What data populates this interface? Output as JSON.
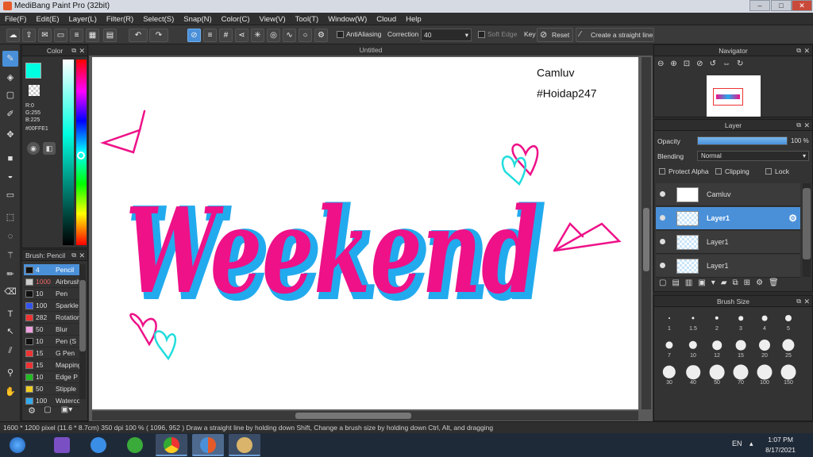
{
  "window": {
    "title": "MediBang Paint Pro (32bit)",
    "minimize": "–",
    "maximize": "□",
    "close": "✕"
  },
  "menu": [
    "File(F)",
    "Edit(E)",
    "Layer(L)",
    "Filter(R)",
    "Select(S)",
    "Snap(N)",
    "Color(C)",
    "View(V)",
    "Tool(T)",
    "Window(W)",
    "Cloud",
    "Help"
  ],
  "toolbar": {
    "antialiasing_label": "AntiAliasing",
    "correction_label": "Correction",
    "correction_value": "40",
    "soft_edge_label": "Soft Edge",
    "key_label": "Key",
    "reset_label": "Reset",
    "straight_line_label": "Create a straight line"
  },
  "color_panel": {
    "title": "Color",
    "r": "R:0",
    "g": "G:255",
    "b": "B:225",
    "hex": "#00FFE1",
    "foreground_color": "#00ffe1",
    "background_color": "#000000"
  },
  "brush_panel": {
    "title": "Brush: Pencil",
    "items": [
      {
        "size": "4",
        "name": "Pencil",
        "color": "#111111",
        "selected": true
      },
      {
        "size": "1000",
        "name": "Airbrush",
        "color": "#cccccc"
      },
      {
        "size": "10",
        "name": "Pen",
        "color": "#111111"
      },
      {
        "size": "100",
        "name": "Sparkle",
        "color": "#3355ee"
      },
      {
        "size": "282",
        "name": "Rotation",
        "color": "#ee3333"
      },
      {
        "size": "50",
        "name": "Blur",
        "color": "#f0a0e0"
      },
      {
        "size": "10",
        "name": "Pen (S",
        "color": "#111111"
      },
      {
        "size": "15",
        "name": "G Pen",
        "color": "#ee3333"
      },
      {
        "size": "15",
        "name": "Mapping",
        "color": "#ee3333"
      },
      {
        "size": "10",
        "name": "Edge P",
        "color": "#22bb22"
      },
      {
        "size": "50",
        "name": "Stipple",
        "color": "#eecc22"
      },
      {
        "size": "100",
        "name": "Watercolor",
        "color": "#33aaee"
      }
    ]
  },
  "canvas": {
    "doc_title": "Untitled",
    "artwork_text": "Weekend",
    "signature_line1": "Camluv",
    "signature_line2": "#Hoidap247",
    "colors": {
      "pink": "#ee1188",
      "cyan": "#22aaee",
      "teal": "#22dddd"
    }
  },
  "navigator": {
    "title": "Navigator"
  },
  "layer_panel": {
    "title": "Layer",
    "opacity_label": "Opacity",
    "opacity_value": "100 %",
    "opacity_fraction": 1.0,
    "blending_label": "Blending",
    "blending_value": "Normal",
    "protect_alpha_label": "Protect Alpha",
    "clipping_label": "Clipping",
    "lock_label": "Lock",
    "layers": [
      {
        "name": "Camluv",
        "selected": false
      },
      {
        "name": "Layer1",
        "selected": true
      },
      {
        "name": "Layer1",
        "selected": false
      },
      {
        "name": "Layer1",
        "selected": false
      }
    ]
  },
  "brush_size_panel": {
    "title": "Brush Size",
    "sizes": [
      "1",
      "1.5",
      "2",
      "3",
      "4",
      "5",
      "7",
      "10",
      "12",
      "15",
      "20",
      "25",
      "30",
      "40",
      "50",
      "70",
      "100",
      "150"
    ]
  },
  "status": {
    "pixel_size": "1600 * 1200 pixel",
    "physical_size": "(11.6 * 8.7cm)",
    "dpi": "350 dpi",
    "zoom": "100 %",
    "cursor_position": "( 1096, 952 )",
    "hint": "Draw a straight line by holding down Shift, Change a brush size by holding down Ctrl, Alt, and dragging"
  },
  "taskbar": {
    "language": "EN",
    "time": "1:07 PM",
    "date": "8/17/2021",
    "apps": [
      "start-button",
      "visual-studio",
      "internet-explorer",
      "coccoc-browser",
      "chrome",
      "medibang",
      "paint"
    ]
  }
}
